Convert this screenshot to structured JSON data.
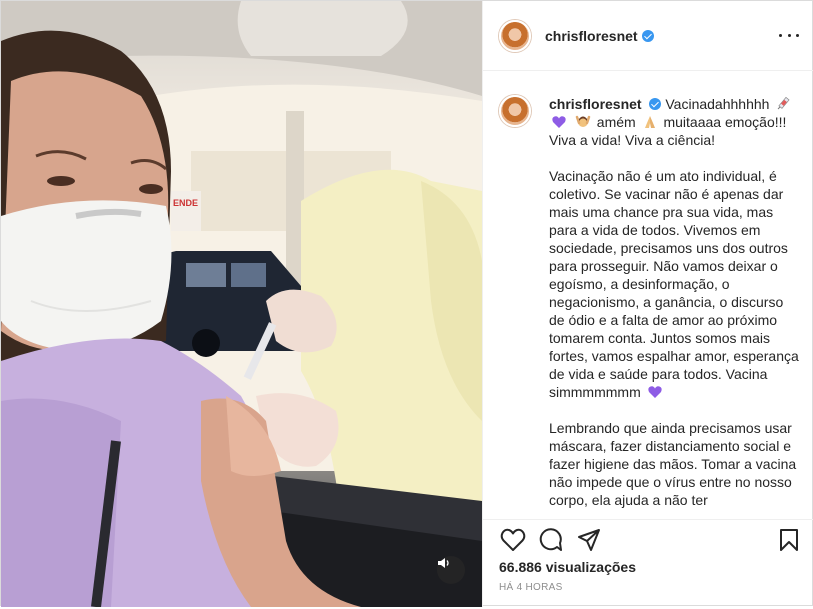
{
  "post": {
    "username": "chrisfloresnet",
    "verified": true,
    "icons": {
      "more": "more-options-icon",
      "like": "heart-icon",
      "comment": "comment-icon",
      "share": "paper-plane-icon",
      "save": "bookmark-icon",
      "mute": "speaker-icon"
    }
  },
  "caption": {
    "username": "chrisfloresnet",
    "line1_a": "Vacinadahhhhhh",
    "line1_b": "amém",
    "line1_c": "muitaaaa emoção!!!",
    "line1_d": "Viva a vida! Viva a ciência!",
    "paragraph2_a": "Vacinação não é um ato individual, é coletivo. Se vacinar não é apenas dar mais uma chance pra sua vida, mas para a vida de todos. Vivemos em sociedade, precisamos uns dos outros para prosseguir. Não vamos deixar o egoísmo, a desinformação, o negacionismo, a ganância, o discurso de ódio e a falta de amor ao próximo tomarem conta. Juntos somos mais fortes, vamos espalhar amor, esperança de vida e saúde para todos. Vacina simmmmmmm",
    "paragraph3": "Lembrando que ainda precisamos usar máscara, fazer distanciamento social e fazer higiene das mãos. Tomar a vacina não impede que o vírus entre no nosso corpo, ela ajuda a não ter"
  },
  "stats": {
    "views": "66.886 visualizações",
    "time": "HÁ 4 HORAS"
  },
  "colors": {
    "verified": "#3897f0",
    "text": "#262626",
    "muted": "#8e8e8e",
    "heart_emoji": "#8e5ce5"
  }
}
